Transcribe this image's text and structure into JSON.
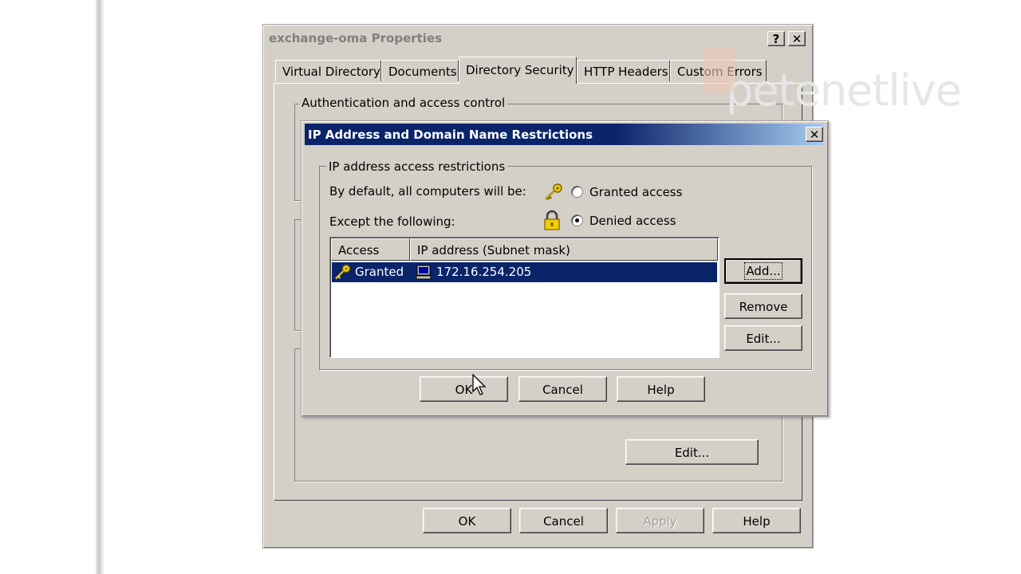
{
  "outer_window": {
    "title": "exchange-oma Properties",
    "help_label": "?",
    "close_label": "✕",
    "tabs": [
      "Virtual Directory",
      "Documents",
      "Directory Security",
      "HTTP Headers",
      "Custom Errors"
    ],
    "active_tab": "Directory Security",
    "group_auth_label": "Authentication and access control",
    "edit_label": "Edit...",
    "buttons": {
      "ok": "OK",
      "cancel": "Cancel",
      "apply": "Apply",
      "help": "Help"
    }
  },
  "dialog": {
    "title": "IP Address and Domain Name Restrictions",
    "close_label": "✕",
    "group_label": "IP address access restrictions",
    "default_label": "By default, all computers will be:",
    "except_label": "Except the following:",
    "granted_label": "Granted access",
    "denied_label": "Denied access",
    "selected_default": "Denied access",
    "list": {
      "columns": [
        "Access",
        "IP address (Subnet mask)"
      ],
      "rows": [
        {
          "access": "Granted",
          "ip": "172.16.254.205"
        }
      ]
    },
    "side_buttons": {
      "add": "Add...",
      "remove": "Remove",
      "edit": "Edit..."
    },
    "buttons": {
      "ok": "OK",
      "cancel": "Cancel",
      "help": "Help"
    }
  },
  "watermark": {
    "text": "petenetlive"
  },
  "colors": {
    "titlebar": "#0a246a",
    "face": "#d4d0c8",
    "selection": "#0a246a"
  },
  "icons": [
    "key-icon",
    "lock-icon",
    "computer-icon",
    "cursor-icon"
  ]
}
